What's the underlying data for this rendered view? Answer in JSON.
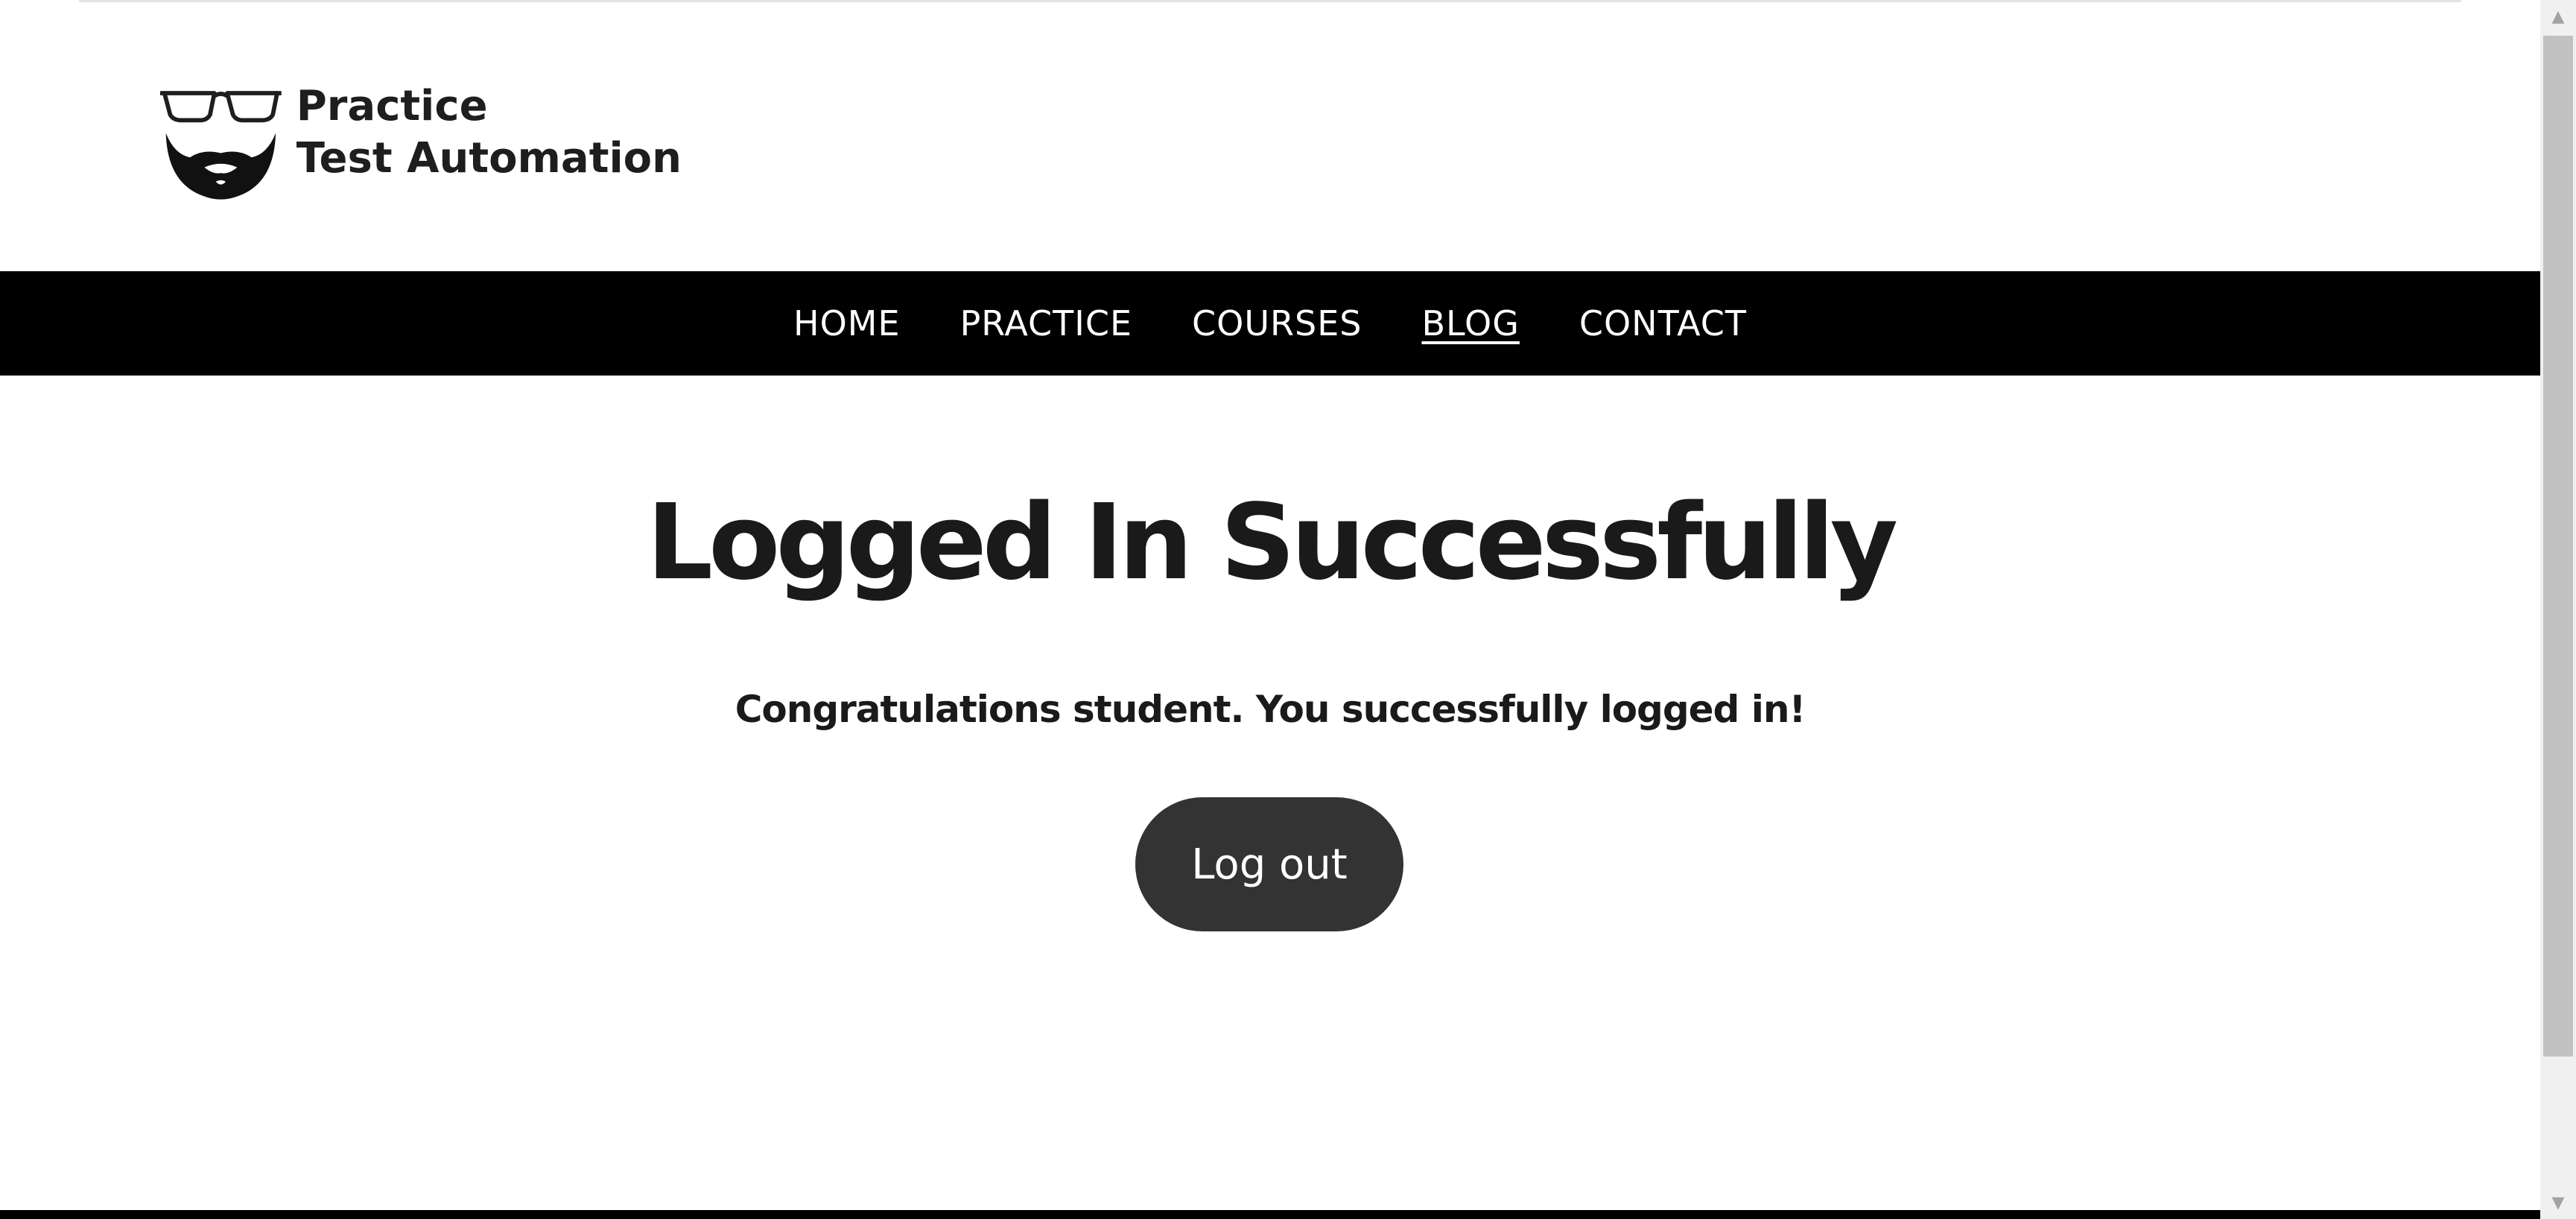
{
  "site": {
    "logo_line_1": "Practice",
    "logo_line_2": "Test Automation"
  },
  "nav": {
    "items": [
      {
        "label": "HOME"
      },
      {
        "label": "PRACTICE"
      },
      {
        "label": "COURSES"
      },
      {
        "label": "BLOG",
        "active": true
      },
      {
        "label": "CONTACT"
      }
    ]
  },
  "post": {
    "title": "Logged In Successfully",
    "message": "Congratulations student. You successfully logged in!",
    "logout_label": "Log out"
  },
  "scrollbar": {
    "up_glyph": "▲",
    "down_glyph": "▼"
  },
  "colors": {
    "nav_background": "#000000",
    "nav_text": "#ffffff",
    "button_background": "#333333",
    "heading_text": "#1a1a1a"
  },
  "icons": [
    "logo-glasses-beard-icon",
    "scroll-up-arrow-icon",
    "scroll-down-arrow-icon"
  ]
}
